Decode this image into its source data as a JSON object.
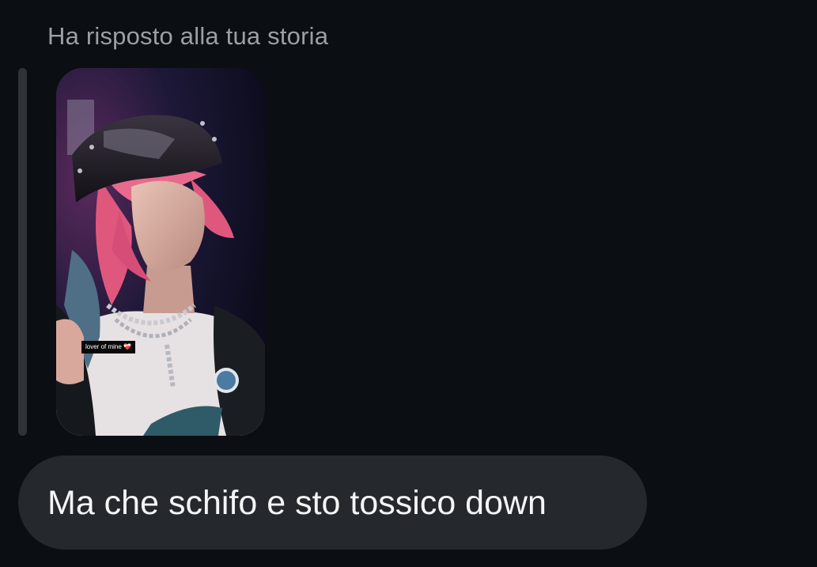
{
  "reply": {
    "header": "Ha risposto alla tua storia"
  },
  "story": {
    "sticker_text": "lover of mine",
    "sticker_emoji": "❤️‍🩹"
  },
  "message": {
    "text": "Ma che schifo e sto tossico down"
  },
  "colors": {
    "background": "#0b0e12",
    "header_text": "#9aa0a6",
    "quote_bar": "#2f3337",
    "bubble": "#25292d",
    "message_text": "#f4f5f6"
  }
}
